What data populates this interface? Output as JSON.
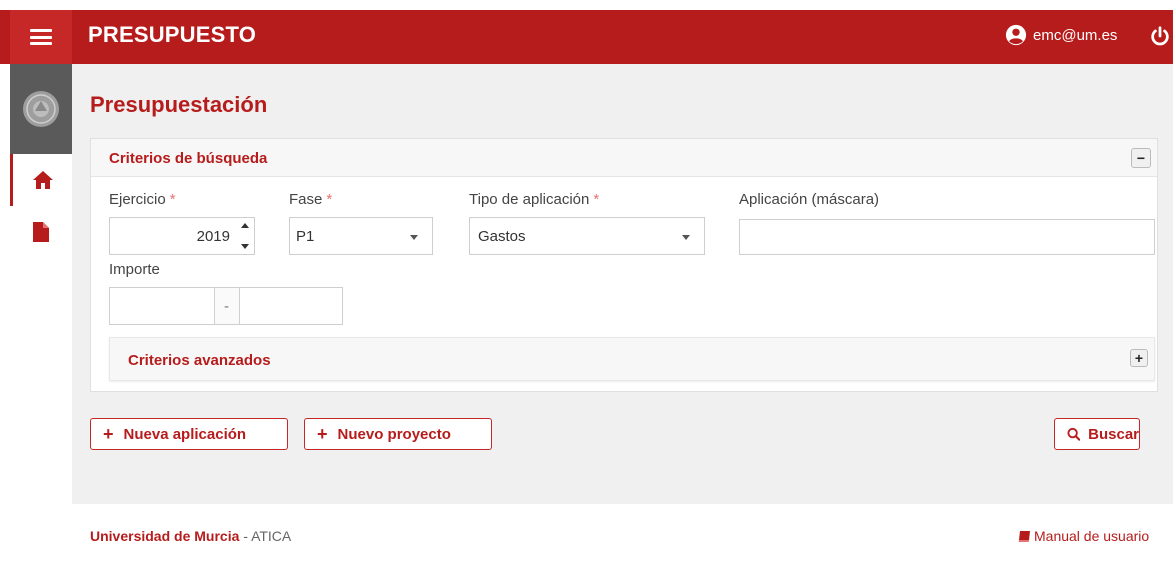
{
  "header": {
    "app_title": "PRESUPUESTO",
    "user_email": "emc@um.es",
    "menu_icon": "hamburger-icon",
    "power_icon": "power-icon"
  },
  "sidebar": {
    "items": [
      {
        "name": "home",
        "icon": "home-icon"
      },
      {
        "name": "document",
        "icon": "document-icon"
      }
    ]
  },
  "page": {
    "title": "Presupuestación"
  },
  "search": {
    "title": "Criterios de búsqueda",
    "collapse_symbol": "−",
    "fields": {
      "ejercicio": {
        "label": "Ejercicio",
        "required": "*",
        "value": "2019"
      },
      "fase": {
        "label": "Fase",
        "required": "*",
        "value": "P1"
      },
      "tipo": {
        "label": "Tipo de aplicación",
        "required": "*",
        "value": "Gastos"
      },
      "aplicacion": {
        "label": "Aplicación (máscara)",
        "value": ""
      },
      "importe": {
        "label": "Importe",
        "from": "",
        "separator": "-",
        "to": ""
      }
    },
    "advanced": {
      "title": "Criterios avanzados",
      "expand_symbol": "+"
    }
  },
  "actions": {
    "new_application": "Nueva aplicación",
    "new_project": "Nuevo proyecto",
    "search": "Buscar"
  },
  "footer": {
    "university": "Universidad de Murcia",
    "separator": " - ",
    "org": "ATICA",
    "manual": "Manual de usuario"
  },
  "colors": {
    "brand": "#b71c1c",
    "sidebar_logo_bg": "#5a5a5a",
    "content_bg": "#f0f0f0"
  }
}
